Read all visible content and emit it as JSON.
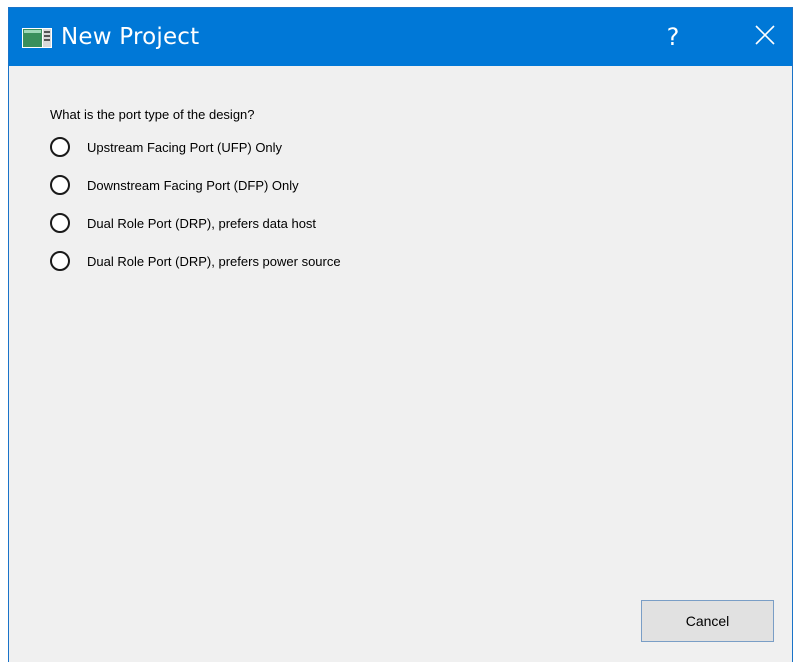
{
  "window": {
    "title": "New Project",
    "help_label": "?"
  },
  "main": {
    "question": "What is the port type of the design?",
    "options": [
      {
        "label": "Upstream Facing Port (UFP) Only",
        "selected": false
      },
      {
        "label": "Downstream Facing Port (DFP) Only",
        "selected": false
      },
      {
        "label": "Dual Role Port (DRP), prefers data host",
        "selected": false
      },
      {
        "label": "Dual Role Port (DRP), prefers power source",
        "selected": false
      }
    ]
  },
  "footer": {
    "cancel_label": "Cancel"
  },
  "colors": {
    "titlebar": "#0078d7",
    "background": "#f0f0f0",
    "button": "#e1e1e1",
    "button_border": "#7a9ec6"
  }
}
